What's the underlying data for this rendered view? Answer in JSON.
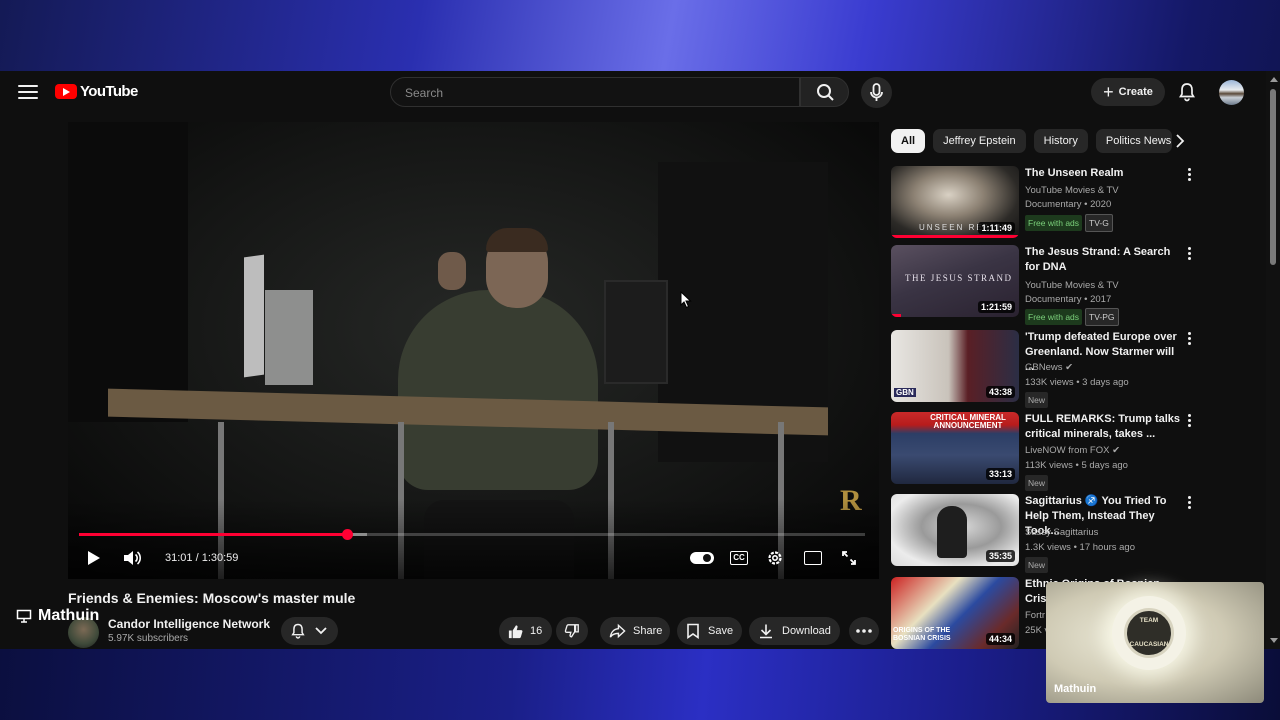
{
  "header": {
    "logo_text": "YouTube",
    "search_placeholder": "Search",
    "create_label": "Create"
  },
  "player": {
    "time_current": "31:01",
    "time_total": "1:30:59",
    "time_display": "31:01 / 1:30:59",
    "progress_fraction": 0.341,
    "cc_label": "CC"
  },
  "video": {
    "title": "Friends & Enemies: Moscow's master mule",
    "channel_name": "Candor Intelligence Network",
    "subscribers": "5.97K subscribers",
    "like_count": "16",
    "share_label": "Share",
    "save_label": "Save",
    "download_label": "Download"
  },
  "chips": [
    "All",
    "Jeffrey Epstein",
    "History",
    "Politics News"
  ],
  "recommendations": [
    {
      "title": "The Unseen Realm",
      "channel": "YouTube Movies & TV",
      "meta": "Documentary • 2020",
      "duration": "1:11:49",
      "badges": [
        "Free with ads",
        "TV-G"
      ],
      "thumb_caption": "UNSEEN REALM",
      "watched_fraction": 1.0
    },
    {
      "title": "The Jesus Strand: A Search for DNA",
      "channel": "YouTube Movies & TV",
      "meta": "Documentary • 2017",
      "duration": "1:21:59",
      "badges": [
        "Free with ads",
        "TV-PG"
      ],
      "thumb_caption": "THE JESUS STRAND",
      "watched_fraction": 0.08
    },
    {
      "title": "'Trump defeated Europe over Greenland. Now Starmer will ...",
      "channel": "GBNews",
      "meta": "133K views • 3 days ago",
      "duration": "43:38",
      "badges": [
        "New"
      ],
      "thumb_caption": "GBN"
    },
    {
      "title": "FULL REMARKS: Trump talks critical minerals, takes ...",
      "channel": "LiveNOW from FOX",
      "meta": "113K views • 5 days ago",
      "duration": "33:13",
      "badges": [
        "New"
      ],
      "thumb_caption": "CRITICAL MINERAL ANNOUNCEMENT"
    },
    {
      "title": "Sagittarius ♐ You Tried To Help Them, Instead They Took...",
      "channel": "Sassy Sagittarius",
      "meta": "1.3K views • 17 hours ago",
      "duration": "35:35",
      "badges": [
        "New"
      ]
    },
    {
      "title": "Ethnic Origins of Bosnian Crisis",
      "channel": "Fortr",
      "meta": "25K v",
      "duration": "44:34",
      "badges": [],
      "thumb_caption": "ORIGINS OF THE BOSNIAN CRISIS"
    }
  ],
  "overlay": {
    "presenter_name": "Mathuin",
    "cam_name": "Mathuin",
    "cam_logo_text": "TEAM CAUCASIAN"
  },
  "colors": {
    "accent": "#ff0033",
    "background": "#0f0f0f",
    "logo_red": "#ff0000"
  }
}
